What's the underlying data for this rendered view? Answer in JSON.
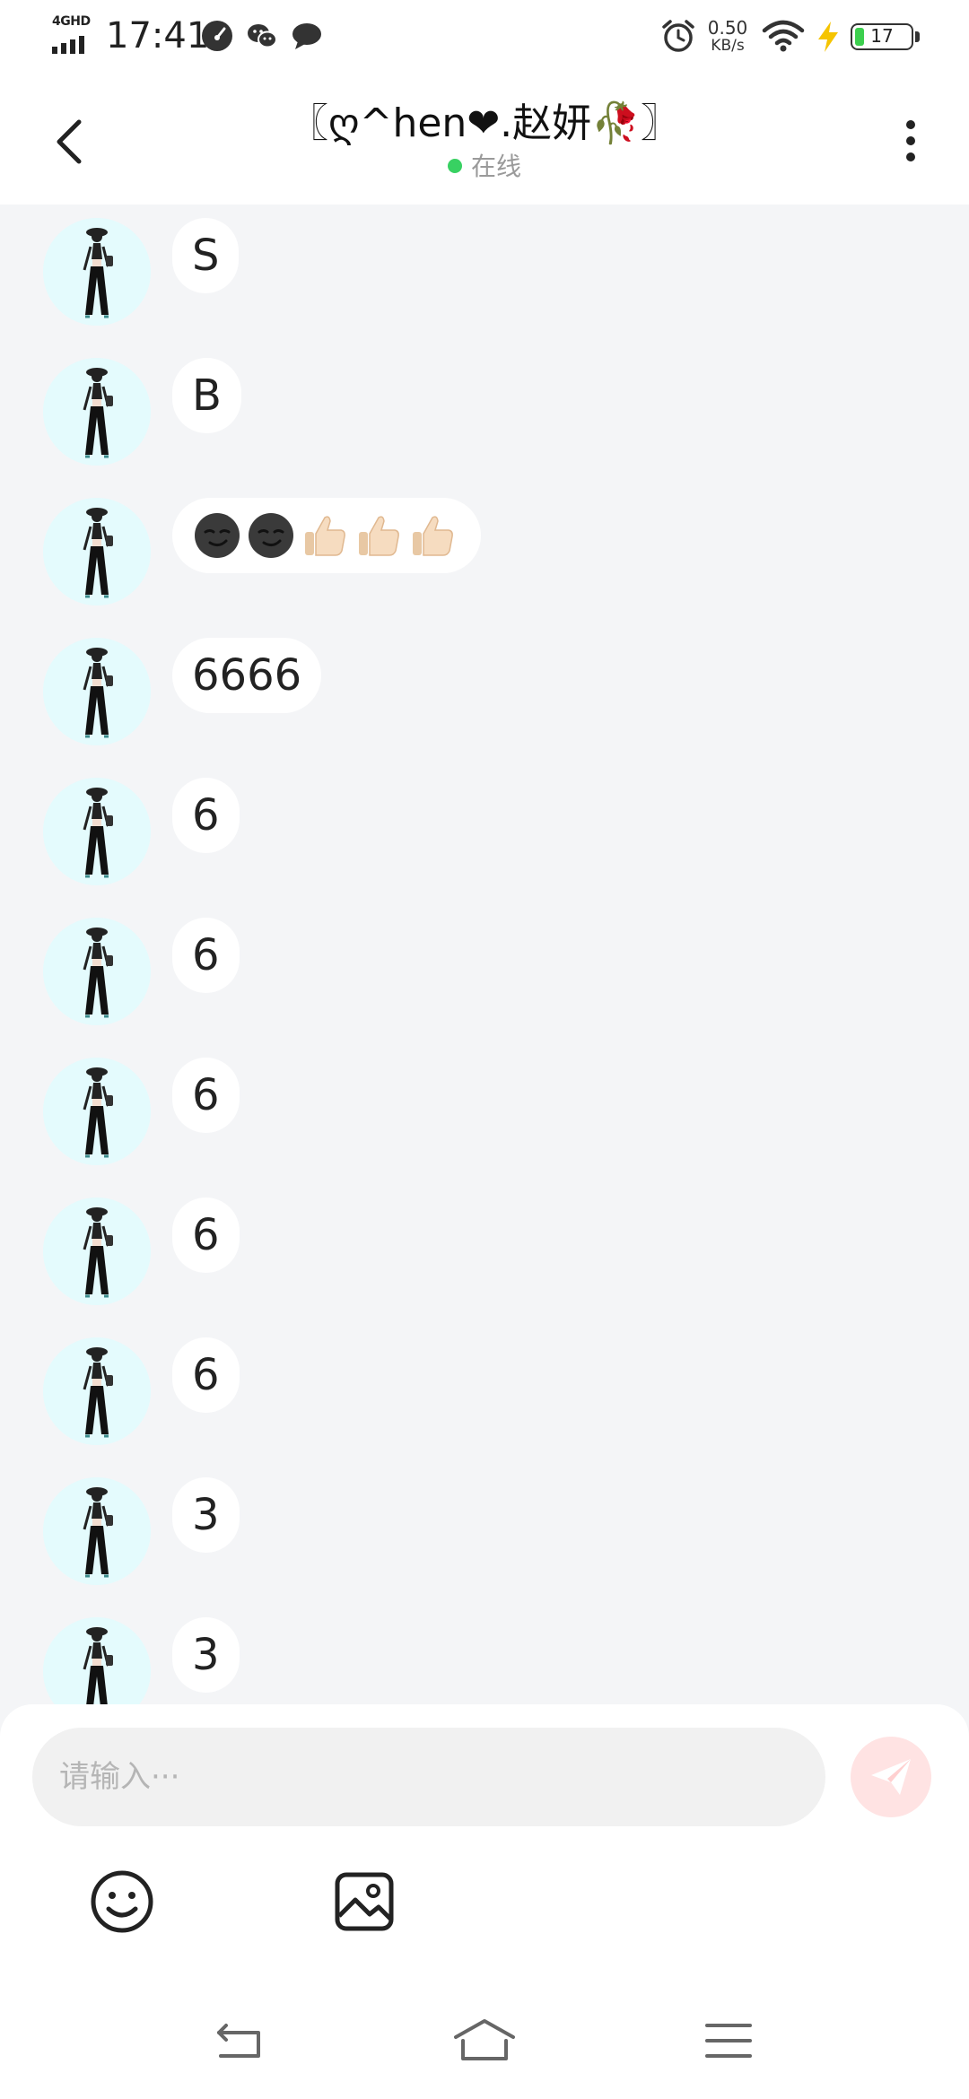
{
  "status_bar": {
    "network": "4GHD",
    "time": "17:41",
    "speed_value": "0.50",
    "speed_unit": "KB/s",
    "battery": "17",
    "battery_level": 0.17,
    "battery_color": "#3ccf4e",
    "icons": [
      "speedometer-icon",
      "wechat-icon",
      "chat-bubble-icon",
      "alarm-icon",
      "wifi-icon",
      "charging-bolt-icon",
      "battery-icon"
    ]
  },
  "header": {
    "title": "〖ღ^hen❤.赵妍🥀〗",
    "presence": "在线",
    "presence_color": "#38d162"
  },
  "messages": [
    {
      "text": "S"
    },
    {
      "text": "B"
    },
    {
      "emoji": [
        "smirk-dark-moon",
        "smirk-dark-moon",
        "thumbs-up",
        "thumbs-up",
        "thumbs-up"
      ]
    },
    {
      "text": "6666"
    },
    {
      "text": "6"
    },
    {
      "text": "6"
    },
    {
      "text": "6"
    },
    {
      "text": "6"
    },
    {
      "text": "6"
    },
    {
      "text": "3"
    },
    {
      "text": "3"
    }
  ],
  "composer": {
    "placeholder": "请输入···",
    "send_color": "#ffe3e3"
  },
  "nav": {
    "icons": [
      "back-nav-icon",
      "home-nav-icon",
      "menu-nav-icon"
    ]
  }
}
